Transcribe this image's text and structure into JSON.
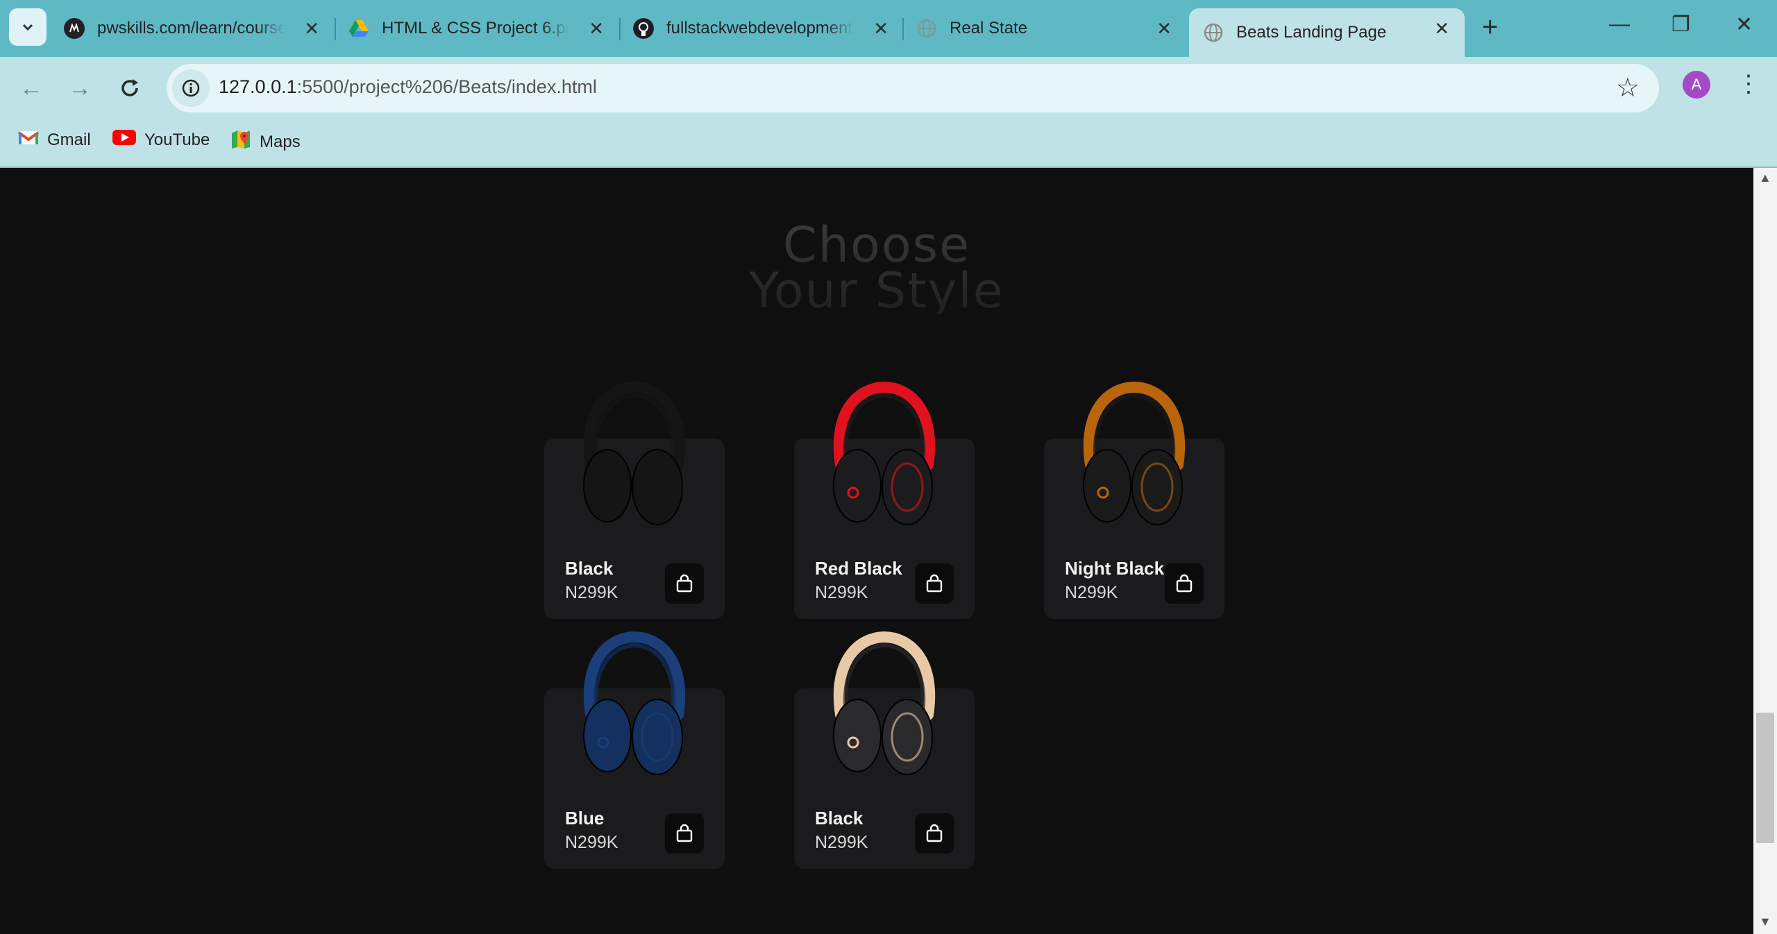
{
  "tabs": [
    {
      "title": "pwskills.com/learn/course"
    },
    {
      "title": "HTML & CSS Project 6.pdf"
    },
    {
      "title": "fullstackwebdevelopment"
    },
    {
      "title": "Real State"
    },
    {
      "title": "Beats Landing Page"
    }
  ],
  "address": {
    "host": "127.0.0.1",
    "rest": ":5500/project%206/Beats/index.html"
  },
  "profile_initial": "A",
  "bookmarks": [
    {
      "label": "Gmail"
    },
    {
      "label": "YouTube"
    },
    {
      "label": "Maps"
    }
  ],
  "section": {
    "heading_line1": "Choose",
    "heading_line2": "Your Style"
  },
  "products": [
    {
      "name": "Black",
      "price": "N299K",
      "color": "#151516",
      "accent": "#151516"
    },
    {
      "name": "Red Black",
      "price": "N299K",
      "color": "#1c1c1e",
      "accent": "#e0121f"
    },
    {
      "name": "Night Black",
      "price": "N299K",
      "color": "#1a1a1b",
      "accent": "#b8650c"
    },
    {
      "name": "Blue",
      "price": "N299K",
      "color": "#13305f",
      "accent": "#1a3f7a"
    },
    {
      "name": "Black",
      "price": "N299K",
      "color": "#2a2a2c",
      "accent": "#e8c9a6"
    }
  ]
}
